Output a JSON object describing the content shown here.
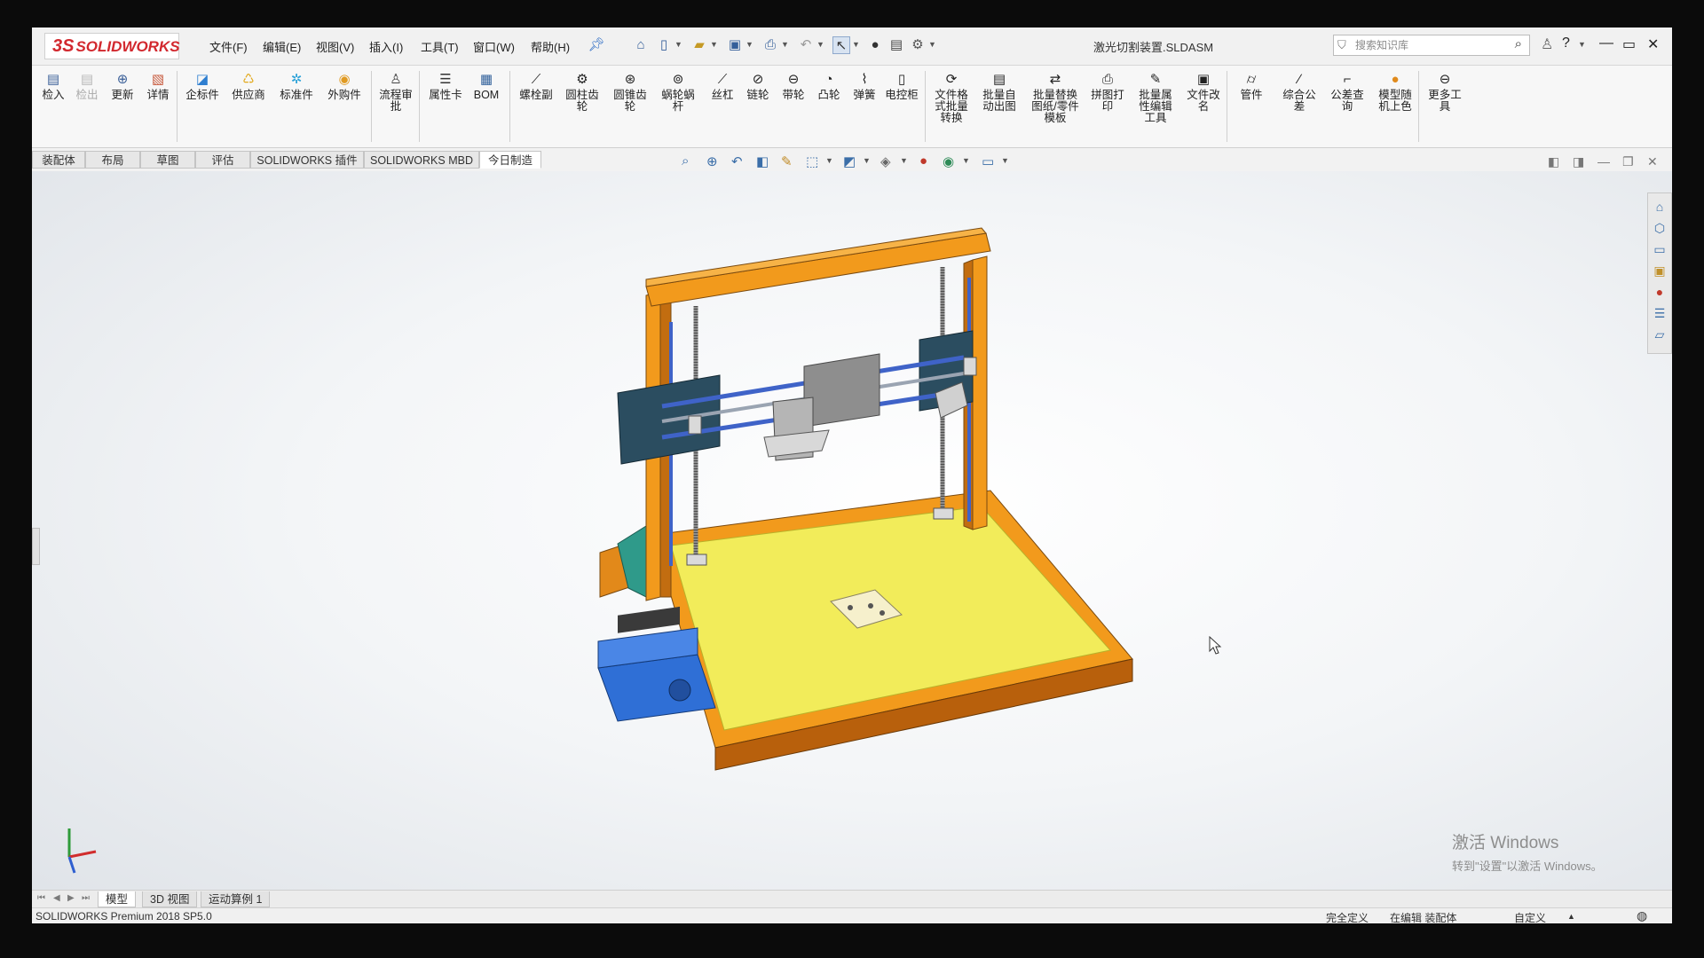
{
  "app": {
    "logo_text": "SOLIDWORKS",
    "logo_mark": "3S",
    "document_title": "激光切割装置.SLDASM"
  },
  "menu": [
    "文件(F)",
    "编辑(E)",
    "视图(V)",
    "插入(I)",
    "工具(T)",
    "窗口(W)",
    "帮助(H)"
  ],
  "search": {
    "placeholder": "搜索知识库"
  },
  "command_manager": [
    {
      "label": "检入",
      "icon": "check-in-icon",
      "color": "#3a5f98"
    },
    {
      "label": "检出",
      "icon": "check-out-icon",
      "color": "#b7b7b7",
      "disabled": true
    },
    {
      "label": "更新",
      "icon": "update-icon",
      "color": "#3a5f98"
    },
    {
      "label": "详情",
      "icon": "details-icon",
      "color": "#c7573a"
    },
    {
      "label": "企标件",
      "icon": "enterprise-part-icon",
      "color": "#2f7fd0"
    },
    {
      "label": "供应商",
      "icon": "supplier-icon",
      "color": "#e2a91c"
    },
    {
      "label": "标准件",
      "icon": "standard-part-icon",
      "color": "#2aa1d8"
    },
    {
      "label": "外购件",
      "icon": "purchased-part-icon",
      "color": "#e09a22"
    },
    {
      "label": "流程审批",
      "icon": "workflow-approval-icon",
      "color": "#444444"
    },
    {
      "label": "属性卡",
      "icon": "property-card-icon",
      "color": "#333333"
    },
    {
      "label": "BOM",
      "icon": "bom-icon",
      "color": "#2f5f9a"
    },
    {
      "label": "螺栓副",
      "icon": "bolt-pair-icon",
      "color": "#333333"
    },
    {
      "label": "圆柱齿轮",
      "icon": "spur-gear-icon",
      "color": "#333333"
    },
    {
      "label": "圆锥齿轮",
      "icon": "bevel-gear-icon",
      "color": "#333333"
    },
    {
      "label": "蜗轮蜗杆",
      "icon": "worm-gear-icon",
      "color": "#333333"
    },
    {
      "label": "丝杠",
      "icon": "lead-screw-icon",
      "color": "#333333"
    },
    {
      "label": "链轮",
      "icon": "sprocket-icon",
      "color": "#333333"
    },
    {
      "label": "带轮",
      "icon": "pulley-icon",
      "color": "#333333"
    },
    {
      "label": "凸轮",
      "icon": "cam-icon",
      "color": "#333333"
    },
    {
      "label": "弹簧",
      "icon": "spring-icon",
      "color": "#333333"
    },
    {
      "label": "电控柜",
      "icon": "control-cabinet-icon",
      "color": "#333333"
    },
    {
      "label": "文件格式批量转换",
      "icon": "batch-convert-icon",
      "color": "#333333"
    },
    {
      "label": "批量自动出图",
      "icon": "batch-drawing-icon",
      "color": "#333333"
    },
    {
      "label": "批量替换图纸/零件模板",
      "icon": "template-replace-icon",
      "color": "#333333"
    },
    {
      "label": "拼图打印",
      "icon": "print-icon",
      "color": "#333333"
    },
    {
      "label": "批量属性编辑工具",
      "icon": "property-edit-icon",
      "color": "#333333"
    },
    {
      "label": "文件改名",
      "icon": "rename-icon",
      "color": "#333333"
    },
    {
      "label": "管件",
      "icon": "pipe-icon",
      "color": "#333333"
    },
    {
      "label": "综合公差",
      "icon": "tolerance-icon",
      "color": "#333333"
    },
    {
      "label": "公差查询",
      "icon": "tolerance-query-icon",
      "color": "#333333"
    },
    {
      "label": "模型随机上色",
      "icon": "random-color-icon",
      "color": "#e08a1c"
    },
    {
      "label": "更多工具",
      "icon": "more-tools-icon",
      "color": "#333333"
    }
  ],
  "tabs": [
    {
      "label": "装配体",
      "active": false
    },
    {
      "label": "布局",
      "active": false
    },
    {
      "label": "草图",
      "active": false
    },
    {
      "label": "评估",
      "active": false
    },
    {
      "label": "SOLIDWORKS 插件",
      "active": false
    },
    {
      "label": "SOLIDWORKS MBD",
      "active": false
    },
    {
      "label": "今日制造",
      "active": true
    }
  ],
  "model_tabs": [
    {
      "label": "模型",
      "active": true
    },
    {
      "label": "3D 视图",
      "active": false
    },
    {
      "label": "运动算例 1",
      "active": false
    }
  ],
  "watermark": {
    "line1": "激活 Windows",
    "line2": "转到\"设置\"以激活 Windows。"
  },
  "status": {
    "product": "SOLIDWORKS Premium 2018 SP5.0",
    "definition": "完全定义",
    "editing": "在编辑 装配体",
    "units": "自定义"
  },
  "colors": {
    "frame": "#f29a1c",
    "bed": "#f2ec5a",
    "rail": "#3f63c8",
    "plate": "#2b4d60",
    "electronics": "#2f6fd6"
  }
}
